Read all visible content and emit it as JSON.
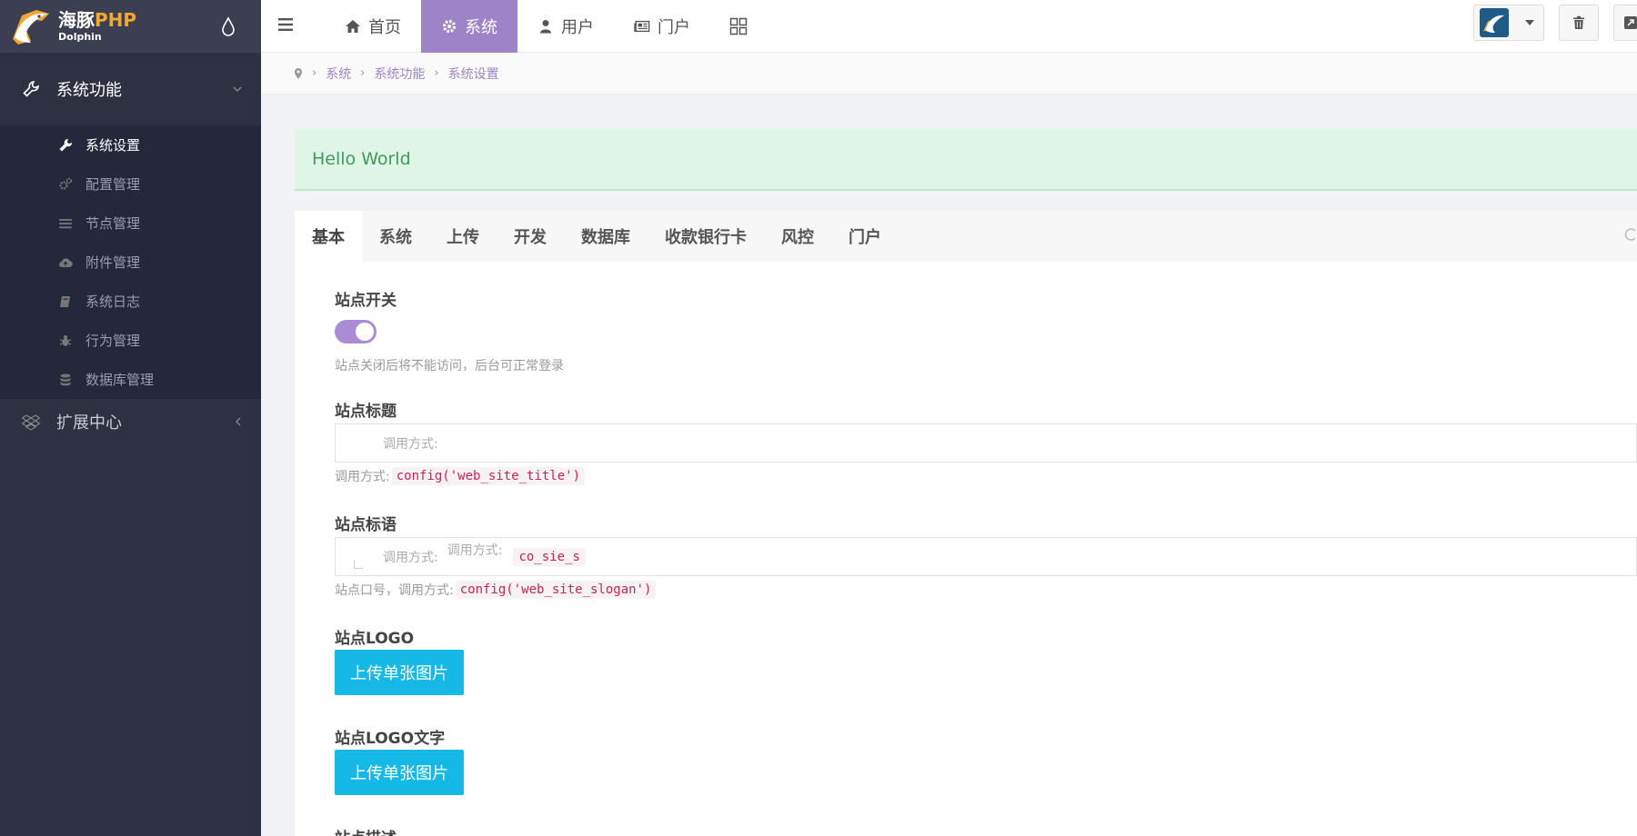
{
  "brand": {
    "name_cn": "海豚",
    "name_php": "PHP",
    "sub": "Dolphin"
  },
  "sidebar": {
    "group1": {
      "label": "系统功能",
      "items": [
        {
          "label": "系统设置",
          "icon": "wrench-icon",
          "active": true
        },
        {
          "label": "配置管理",
          "icon": "gears-icon"
        },
        {
          "label": "节点管理",
          "icon": "list-icon"
        },
        {
          "label": "附件管理",
          "icon": "cloud-upload-icon"
        },
        {
          "label": "系统日志",
          "icon": "book-icon"
        },
        {
          "label": "行为管理",
          "icon": "bug-icon"
        },
        {
          "label": "数据库管理",
          "icon": "database-icon"
        }
      ]
    },
    "group2": {
      "label": "扩展中心"
    }
  },
  "topbar": {
    "tabs": [
      {
        "label": "首页",
        "icon": "home-icon"
      },
      {
        "label": "系统",
        "icon": "gear-icon",
        "active": true
      },
      {
        "label": "用户",
        "icon": "user-icon"
      },
      {
        "label": "门户",
        "icon": "newspaper-icon"
      }
    ]
  },
  "breadcrumb": [
    "系统",
    "系统功能",
    "系统设置"
  ],
  "alert": {
    "text": "Hello World"
  },
  "tabs": [
    "基本",
    "系统",
    "上传",
    "开发",
    "数据库",
    "收款银行卡",
    "风控",
    "门户"
  ],
  "form": {
    "site_switch": {
      "label": "站点开关",
      "on": true,
      "help": "站点关闭后将不能访问，后台可正常登录"
    },
    "site_title": {
      "label": "站点标题",
      "input_ghost": "调用方式:",
      "help_prefix": "调用方式:",
      "help_code": "config('web_site_title')"
    },
    "site_slogan": {
      "label": "站点标语",
      "input_ghost1": "调用方式:",
      "input_ghost2": "调用方式:",
      "input_ghost_code": "co_sie_s",
      "help_prefix": "站点口号，调用方式:",
      "help_code": "config('web_site_slogan')"
    },
    "site_logo": {
      "label": "站点LOGO",
      "button": "上传单张图片"
    },
    "site_logo_text": {
      "label": "站点LOGO文字",
      "button": "上传单张图片"
    },
    "site_desc": {
      "label": "站点描述"
    }
  },
  "colors": {
    "accent": "#9d84c9",
    "sidebar": "#2d3142",
    "upload": "#16b9e6",
    "alert_bg": "#dff5e8"
  }
}
